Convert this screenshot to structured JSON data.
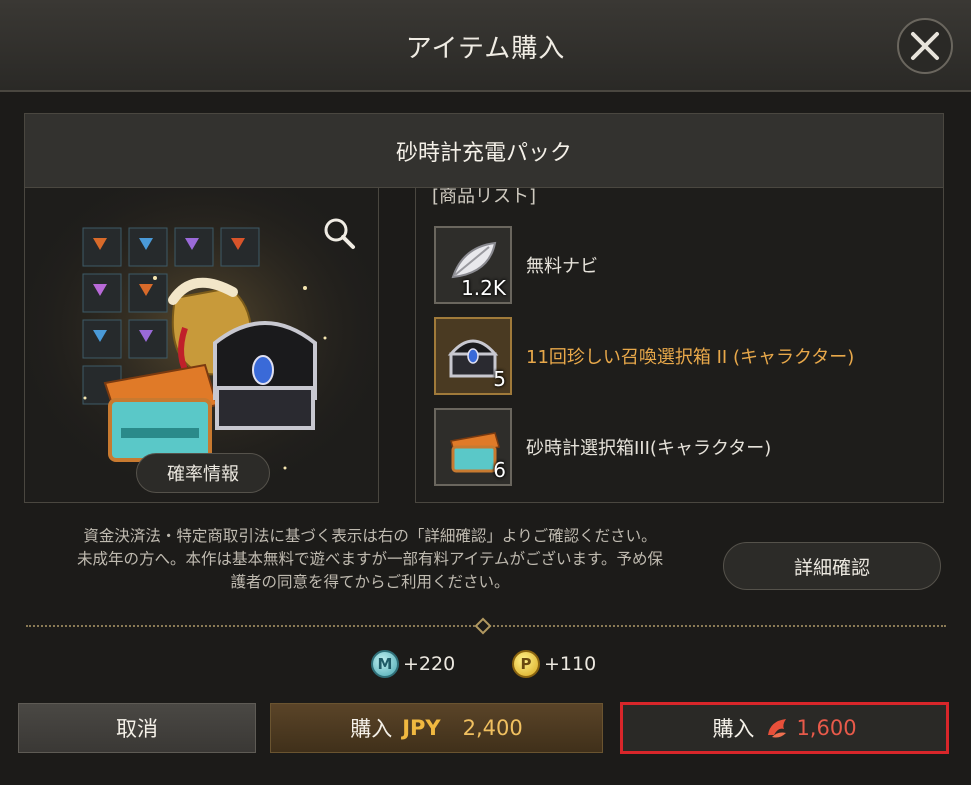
{
  "dialog": {
    "title": "アイテム購入"
  },
  "product": {
    "name": "砂時計充電パック",
    "list_heading": "[商品リスト]",
    "probability_button": "確率情報",
    "items": [
      {
        "label": "無料ナビ",
        "quantity": "1.2K",
        "highlight": false
      },
      {
        "label": "11回珍しい召喚選択箱 II (キャラクター)",
        "quantity": "5",
        "highlight": true
      },
      {
        "label": "砂時計選択箱III(キャラクター)",
        "quantity": "6",
        "highlight": false
      }
    ]
  },
  "notice": {
    "line1": "資金決済法・特定商取引法に基づく表示は右の「詳細確認」よりご確認ください。",
    "line2": "未成年の方へ。本作は基本無料で遊べますが一部有料アイテムがございます。予め保",
    "line3": "護者の同意を得てからご利用ください。",
    "detail_button": "詳細確認"
  },
  "rewards": [
    {
      "icon": "m-coin-icon",
      "coin_letter": "M",
      "amount": "+220"
    },
    {
      "icon": "p-coin-icon",
      "coin_letter": "P",
      "amount": "+110"
    }
  ],
  "buttons": {
    "cancel": "取消",
    "buy_jpy_label": "購入",
    "buy_jpy_currency": "JPY",
    "buy_jpy_amount": "2,400",
    "buy_gem_label": "購入",
    "buy_gem_amount": "1,600"
  },
  "colors": {
    "highlight_text": "#e8a84a",
    "selected_border": "#d8262a",
    "gem_price": "#e85a4a"
  }
}
